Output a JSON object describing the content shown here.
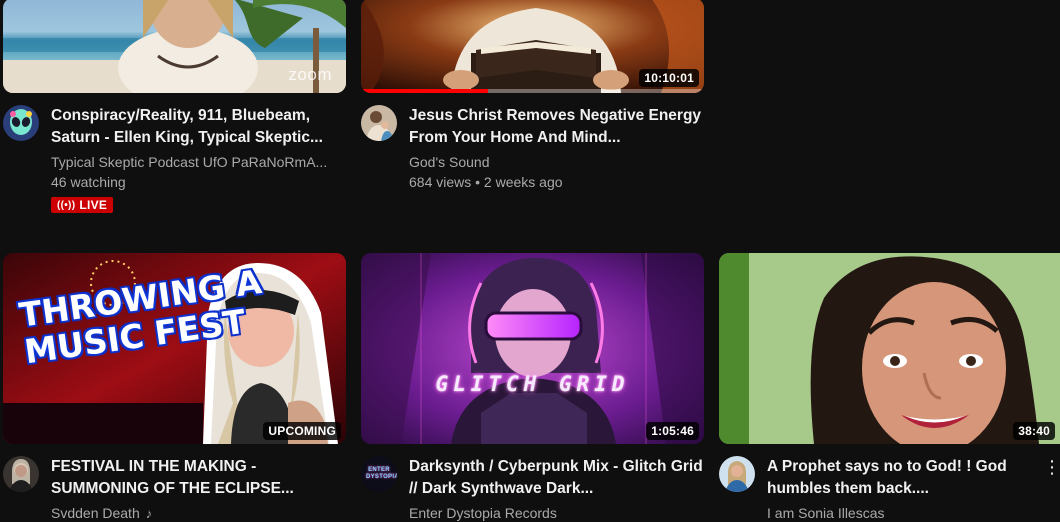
{
  "videos": [
    {
      "title": "Conspiracy/Reality, 911, Bluebeam, Saturn - Ellen King, Typical Skeptic...",
      "channel": "Typical Skeptic Podcast UfO PaRaNoRmA...",
      "stats": "46 watching",
      "live_label": "LIVE",
      "thumb_text": "zoom"
    },
    {
      "title": "Jesus Christ Removes Negative Energy From Your Home And Mind...",
      "channel": "God's Sound",
      "stats": "684 views • 2 weeks ago",
      "duration": "10:10:01",
      "watched_fraction": 0.37
    },
    {
      "title": "FESTIVAL IN THE MAKING - SUMMONING OF THE ECLIPSE...",
      "channel": "Svdden Death",
      "badge": "UPCOMING",
      "thumb_text": [
        "THROWING A",
        "MUSIC FEST"
      ]
    },
    {
      "title": "Darksynth / Cyberpunk Mix - Glitch Grid // Dark Synthwave Dark...",
      "channel": "Enter Dystopia Records",
      "duration": "1:05:46",
      "thumb_text": "GLITCH GRID",
      "avatar_text": "ENTER DYSTOPIA"
    },
    {
      "title": "A Prophet says no to God! ! God humbles them back....",
      "channel": "I am Sonia Illescas",
      "duration": "38:40"
    }
  ],
  "icons": {
    "live": "broadcast-icon",
    "music_note": "music-note-icon",
    "more": "more-vert-icon"
  },
  "colors": {
    "background": "#0f0f0f",
    "live_badge": "#cc0000",
    "progress": "#ff0000"
  }
}
